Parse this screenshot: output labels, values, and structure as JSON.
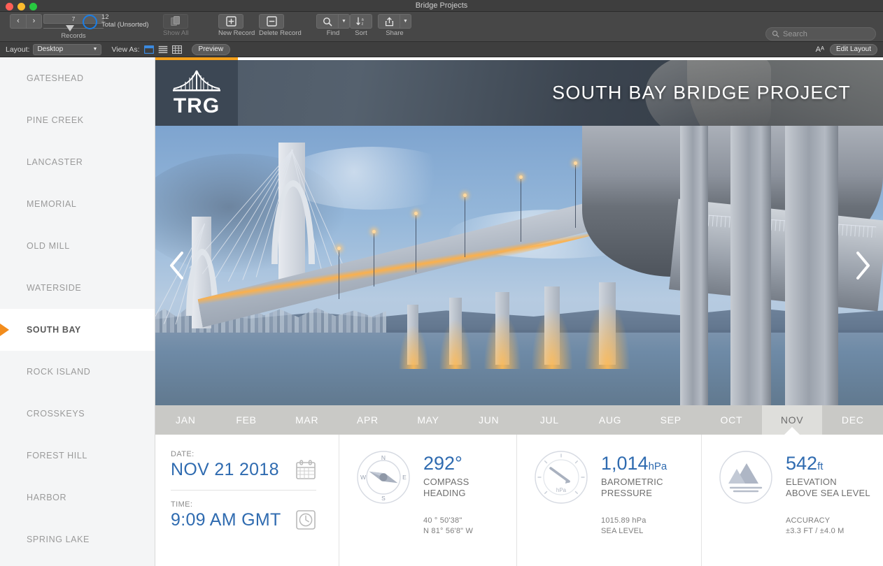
{
  "window": {
    "title": "Bridge Projects",
    "traffic_lights": [
      "close-button",
      "minimize-button",
      "zoom-button"
    ]
  },
  "toolbar": {
    "prev_label": "‹",
    "next_label": "›",
    "record_number": "7",
    "records_label": "Records",
    "total_count": "12",
    "total_label": "Total (Unsorted)",
    "show_all_label": "Show All",
    "new_record_label": "New Record",
    "delete_record_label": "Delete Record",
    "find_label": "Find",
    "sort_label": "Sort",
    "share_label": "Share",
    "search_placeholder": "Search"
  },
  "layoutbar": {
    "layout_label": "Layout:",
    "layout_value": "Desktop",
    "view_as_label": "View As:",
    "preview_label": "Preview",
    "text_format_label": "Aᴬ",
    "edit_layout_label": "Edit Layout"
  },
  "sidebar": {
    "items": [
      {
        "label": "GATESHEAD",
        "active": false
      },
      {
        "label": "PINE CREEK",
        "active": false
      },
      {
        "label": "LANCASTER",
        "active": false
      },
      {
        "label": "MEMORIAL",
        "active": false
      },
      {
        "label": "OLD MILL",
        "active": false
      },
      {
        "label": "WATERSIDE",
        "active": false
      },
      {
        "label": "SOUTH BAY",
        "active": true
      },
      {
        "label": "ROCK ISLAND",
        "active": false
      },
      {
        "label": "CROSSKEYS",
        "active": false
      },
      {
        "label": "FOREST HILL",
        "active": false
      },
      {
        "label": "HARBOR",
        "active": false
      },
      {
        "label": "SPRING LAKE",
        "active": false
      }
    ]
  },
  "hero": {
    "logo_text": "TRG",
    "title": "SOUTH BAY BRIDGE PROJECT",
    "prev_arrow": "previous-photo",
    "next_arrow": "next-photo"
  },
  "months": {
    "items": [
      {
        "label": "JAN",
        "active": false
      },
      {
        "label": "FEB",
        "active": false
      },
      {
        "label": "MAR",
        "active": false
      },
      {
        "label": "APR",
        "active": false
      },
      {
        "label": "MAY",
        "active": false
      },
      {
        "label": "JUN",
        "active": false
      },
      {
        "label": "JUL",
        "active": false
      },
      {
        "label": "AUG",
        "active": false
      },
      {
        "label": "SEP",
        "active": false
      },
      {
        "label": "OCT",
        "active": false
      },
      {
        "label": "NOV",
        "active": true
      },
      {
        "label": "DEC",
        "active": false
      }
    ]
  },
  "details": {
    "date": {
      "label": "DATE:",
      "value": "NOV 21 2018",
      "icon": "calendar-icon"
    },
    "time": {
      "label": "TIME:",
      "value": "9:09 AM GMT",
      "icon": "clock-icon"
    },
    "compass": {
      "value": "292°",
      "caption_line1": "COMPASS",
      "caption_line2": "HEADING",
      "sub_line1": "40 ° 50'38\"",
      "sub_line2": "N 81° 56'8\" W",
      "icon": "compass-icon",
      "needle_heading_deg": 292,
      "cardinals": [
        "N",
        "E",
        "S",
        "W"
      ]
    },
    "barometer": {
      "value": "1,014",
      "unit": "hPa",
      "caption_line1": "BAROMETRIC",
      "caption_line2": "PRESSURE",
      "sub_line1": "1015.89 hPa",
      "sub_line2": "SEA LEVEL",
      "icon": "barometer-icon",
      "dial_label": "hPa"
    },
    "elevation": {
      "value": "542",
      "unit": "ft",
      "caption_line1": "ELEVATION",
      "caption_line2": "ABOVE SEA LEVEL",
      "sub_line1": "ACCURACY",
      "sub_line2": "±3.3 FT / ±4.0 M",
      "icon": "mountain-icon"
    }
  },
  "colors": {
    "accent_orange": "#f3a01c",
    "value_blue": "#2f6bb0",
    "selection_marker": "#f28c1c",
    "toolbar_bg": "#474747",
    "header_slate": "#3c4754",
    "month_bar": "#c9c9c6",
    "month_active": "#dededb"
  }
}
